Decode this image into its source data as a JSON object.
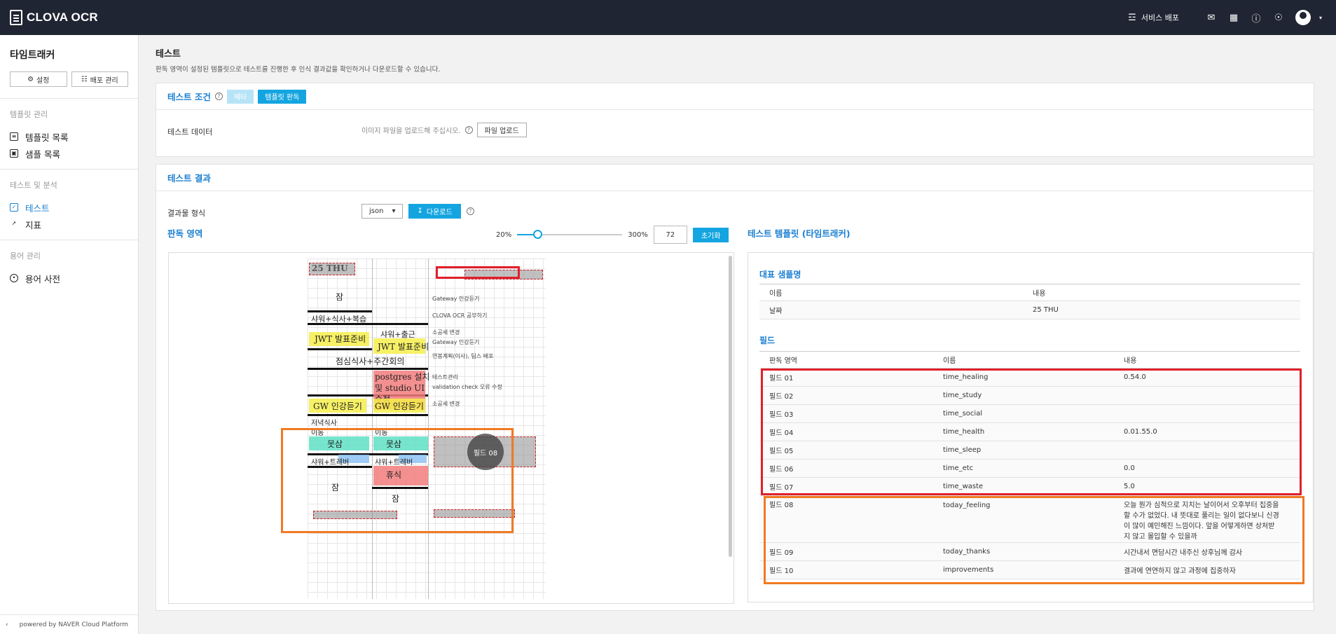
{
  "header": {
    "brand": "CLOVA OCR",
    "deploy_label": "서비스 배포"
  },
  "sidebar": {
    "title": "타임트래커",
    "settings_btn": "설정",
    "deploy_btn": "배포 관리",
    "sections": [
      {
        "title": "템플릿 관리",
        "items": [
          "템플릿 목록",
          "샘플 목록"
        ]
      },
      {
        "title": "테스트 및 분석",
        "items": [
          "테스트",
          "지표"
        ]
      },
      {
        "title": "용어 관리",
        "items": [
          "용어 사전"
        ]
      }
    ],
    "footer": "powered by NAVER Cloud Platform"
  },
  "page": {
    "title": "테스트",
    "desc": "판독 영역이 설정된 템플릿으로 테스트를 진행한 후 인식 결과값을 확인하거나 다운로드할 수 있습니다."
  },
  "condition": {
    "title": "테스트 조건",
    "pill_general": "메타",
    "pill_template": "템플릿 판독",
    "data_label": "테스트 데이터",
    "upload_hint": "이미지 파일을 업로드해 주십시오.",
    "upload_btn": "파일 업로드"
  },
  "result": {
    "title": "테스트 결과",
    "format_label": "결과물 형식",
    "format_value": "json",
    "download_btn": "다운로드",
    "area_title": "판독 영역",
    "zoom_min": "20%",
    "zoom_max": "300%",
    "zoom_value": "72",
    "zoom_level": 0.19,
    "reset_btn": "초기화",
    "field_badge": "필드 08"
  },
  "sheet": {
    "date": "25 THU",
    "notes": [
      "Gateway 인강듣기",
      "CLOVA OCR 공부하기",
      "소공세 변경",
      "Gateway 인강듣기",
      "연봉계획(이사), 팀스 배포",
      "테스트관리",
      "validation check 오류 수정",
      "소공세 변경"
    ],
    "left_items": [
      "잠",
      "샤워+식사+복습",
      "JWT 발표준비",
      "점심식사+주간회의",
      "GW 인강듣기",
      "저녁식사",
      "이동",
      "못삼",
      "샤워+트레버",
      "잠"
    ],
    "right_items": [
      "샤워+출근",
      "JWT 발표준비",
      "postgres 설치",
      "및 studio UI",
      "수정",
      "GW 인강듣기",
      "이동",
      "못삼",
      "샤워+트레버",
      "휴식",
      "잠"
    ]
  },
  "template": {
    "title": "테스트 템플릿 (타임트래커)",
    "rep_title": "대표 샘플명",
    "rep_headers": [
      "이름",
      "내용"
    ],
    "rep_rows": [
      [
        "날짜",
        "25 THU"
      ]
    ],
    "field_title": "필드",
    "field_headers": [
      "판독 영역",
      "이름",
      "내용"
    ],
    "fields": [
      [
        "필드 01",
        "time_healing",
        "0.54.0"
      ],
      [
        "필드 02",
        "time_study",
        ""
      ],
      [
        "필드 03",
        "time_social",
        ""
      ],
      [
        "필드 04",
        "time_health",
        "0.01.55.0"
      ],
      [
        "필드 05",
        "time_sleep",
        ""
      ],
      [
        "필드 06",
        "time_etc",
        "0.0"
      ],
      [
        "필드 07",
        "time_waste",
        "5.0"
      ],
      [
        "필드 08",
        "today_feeling",
        "오늘 뭔가 심적으로 지치는 날이어서 오후부터 집중을 할 수가 없었다. 내 뜻대로 풀리는 일이 없다보니 신경이 많이 예민해진 느낌이다. 앞을 어떻게하면 상처받지 않고 몰입할 수 있을까"
      ],
      [
        "필드 09",
        "today_thanks",
        "시간내서 면담시간 내주신 상후님께 감사"
      ],
      [
        "필드 10",
        "improvements",
        "결과에 연연하지 않고 과정에 집중하자"
      ]
    ]
  },
  "colors": {
    "accent": "#14a5e0",
    "red": "#e0202a",
    "orange": "#f07a22",
    "topbar": "#1f2532"
  }
}
